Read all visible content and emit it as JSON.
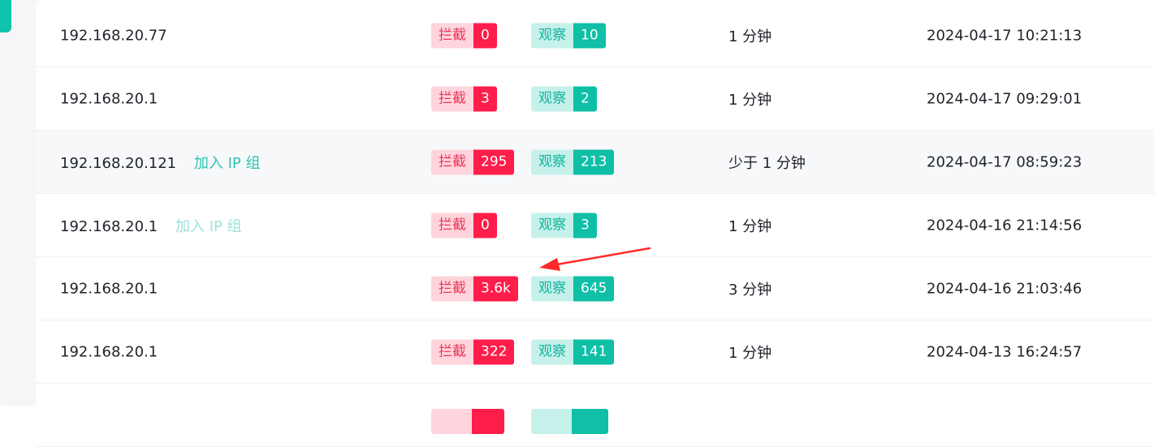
{
  "colors": {
    "accent": "#10c3ad",
    "block_label_bg": "#ffd4dc",
    "block_value_bg": "#ff1d4b",
    "watch_label_bg": "#c6f1ea",
    "watch_value_bg": "#0fbfa6",
    "annotation_arrow": "#ff2a2a"
  },
  "labels": {
    "block": "拦截",
    "watch": "观察"
  },
  "rows": [
    {
      "ip": "192.168.20.77",
      "link": "",
      "block": "0",
      "watch": "10",
      "duration": "1 分钟",
      "time": "2024-04-17 10:21:13"
    },
    {
      "ip": "192.168.20.1",
      "link": "",
      "block": "3",
      "watch": "2",
      "duration": "1 分钟",
      "time": "2024-04-17 09:29:01"
    },
    {
      "ip": "192.168.20.121",
      "link": "加入 IP 组",
      "block": "295",
      "watch": "213",
      "duration": "少于 1 分钟",
      "time": "2024-04-17 08:59:23"
    },
    {
      "ip": "192.168.20.1",
      "link": "加入 IP 组",
      "block": "0",
      "watch": "3",
      "duration": "1 分钟",
      "time": "2024-04-16 21:14:56"
    },
    {
      "ip": "192.168.20.1",
      "link": "",
      "block": "3.6k",
      "watch": "645",
      "duration": "3 分钟",
      "time": "2024-04-16 21:03:46"
    },
    {
      "ip": "192.168.20.1",
      "link": "",
      "block": "322",
      "watch": "141",
      "duration": "1 分钟",
      "time": "2024-04-13 16:24:57"
    },
    {
      "ip": "",
      "link": "",
      "block": "",
      "watch": "",
      "duration": "",
      "time": ""
    }
  ]
}
